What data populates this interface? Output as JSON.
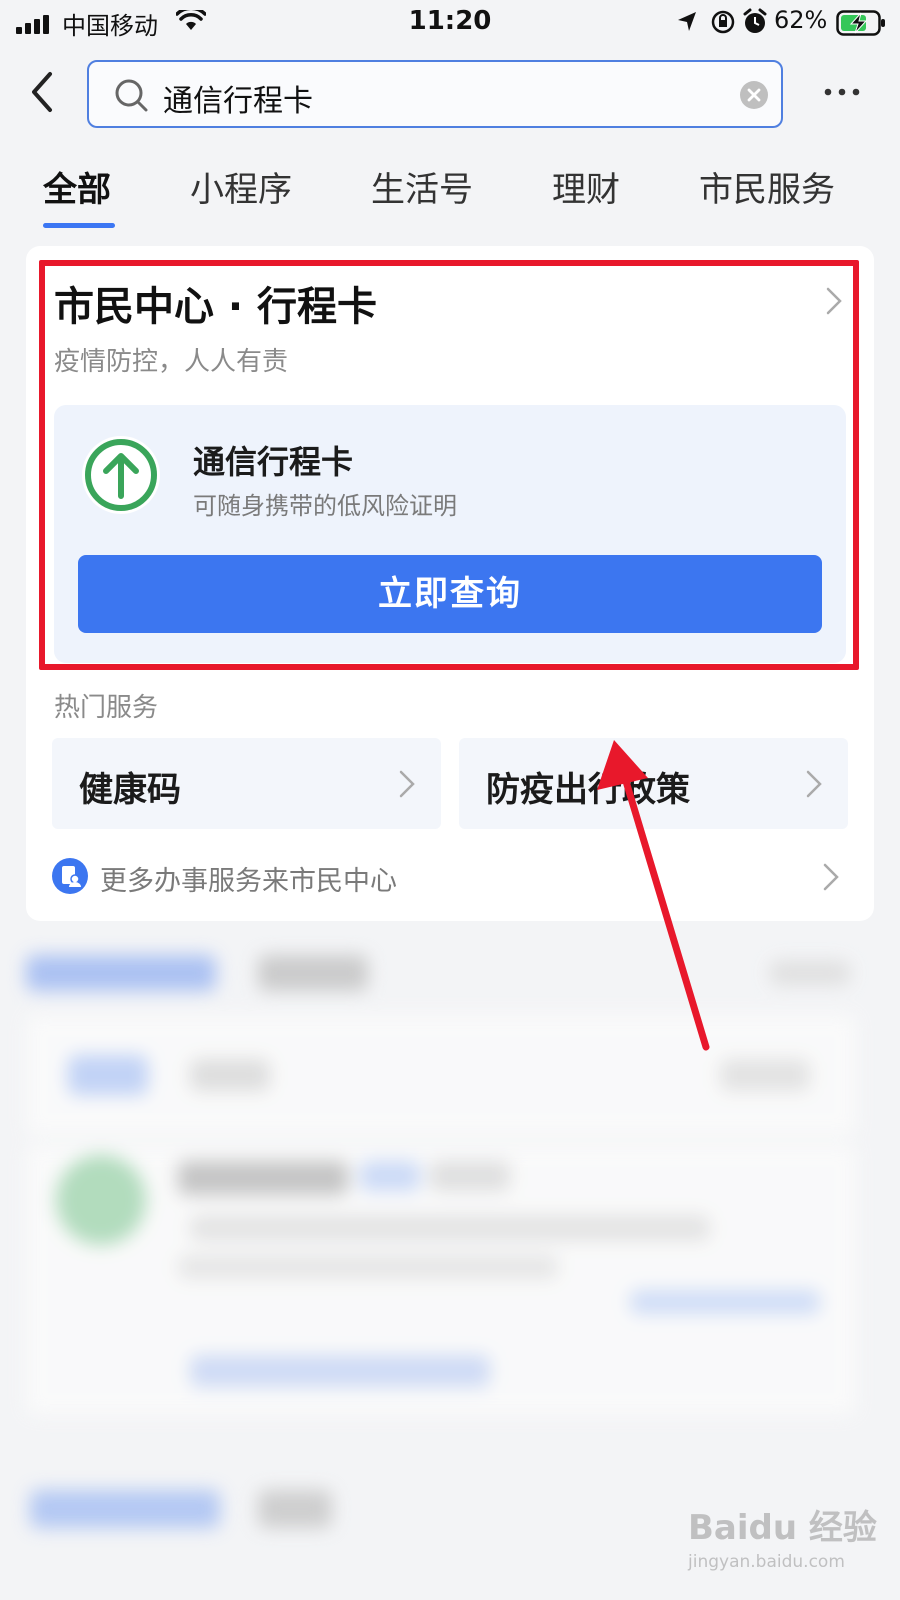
{
  "status_bar": {
    "carrier": "中国移动",
    "time": "11:20",
    "battery": "62%"
  },
  "search": {
    "query": "通信行程卡"
  },
  "tabs": [
    {
      "label": "全部",
      "active": true
    },
    {
      "label": "小程序",
      "active": false
    },
    {
      "label": "生活号",
      "active": false
    },
    {
      "label": "理财",
      "active": false
    },
    {
      "label": "市民服务",
      "active": false
    }
  ],
  "card": {
    "title": "市民中心 · 行程卡",
    "subtitle": "疫情防控，人人有责",
    "service": {
      "icon": "arrow-up-circle-icon",
      "name": "通信行程卡",
      "description": "可随身携带的低风险证明",
      "button_label": "立即查询"
    },
    "hot_services_title": "热门服务",
    "hot_services": [
      {
        "label": "健康码"
      },
      {
        "label": "防疫出行政策"
      }
    ],
    "more_link": "更多办事服务来市民中心"
  },
  "colors": {
    "accent": "#3c76f0",
    "highlight": "#e8182b",
    "success": "#3aa55a"
  },
  "watermark": {
    "brand": "Baidu 经验",
    "url": "jingyan.baidu.com"
  }
}
